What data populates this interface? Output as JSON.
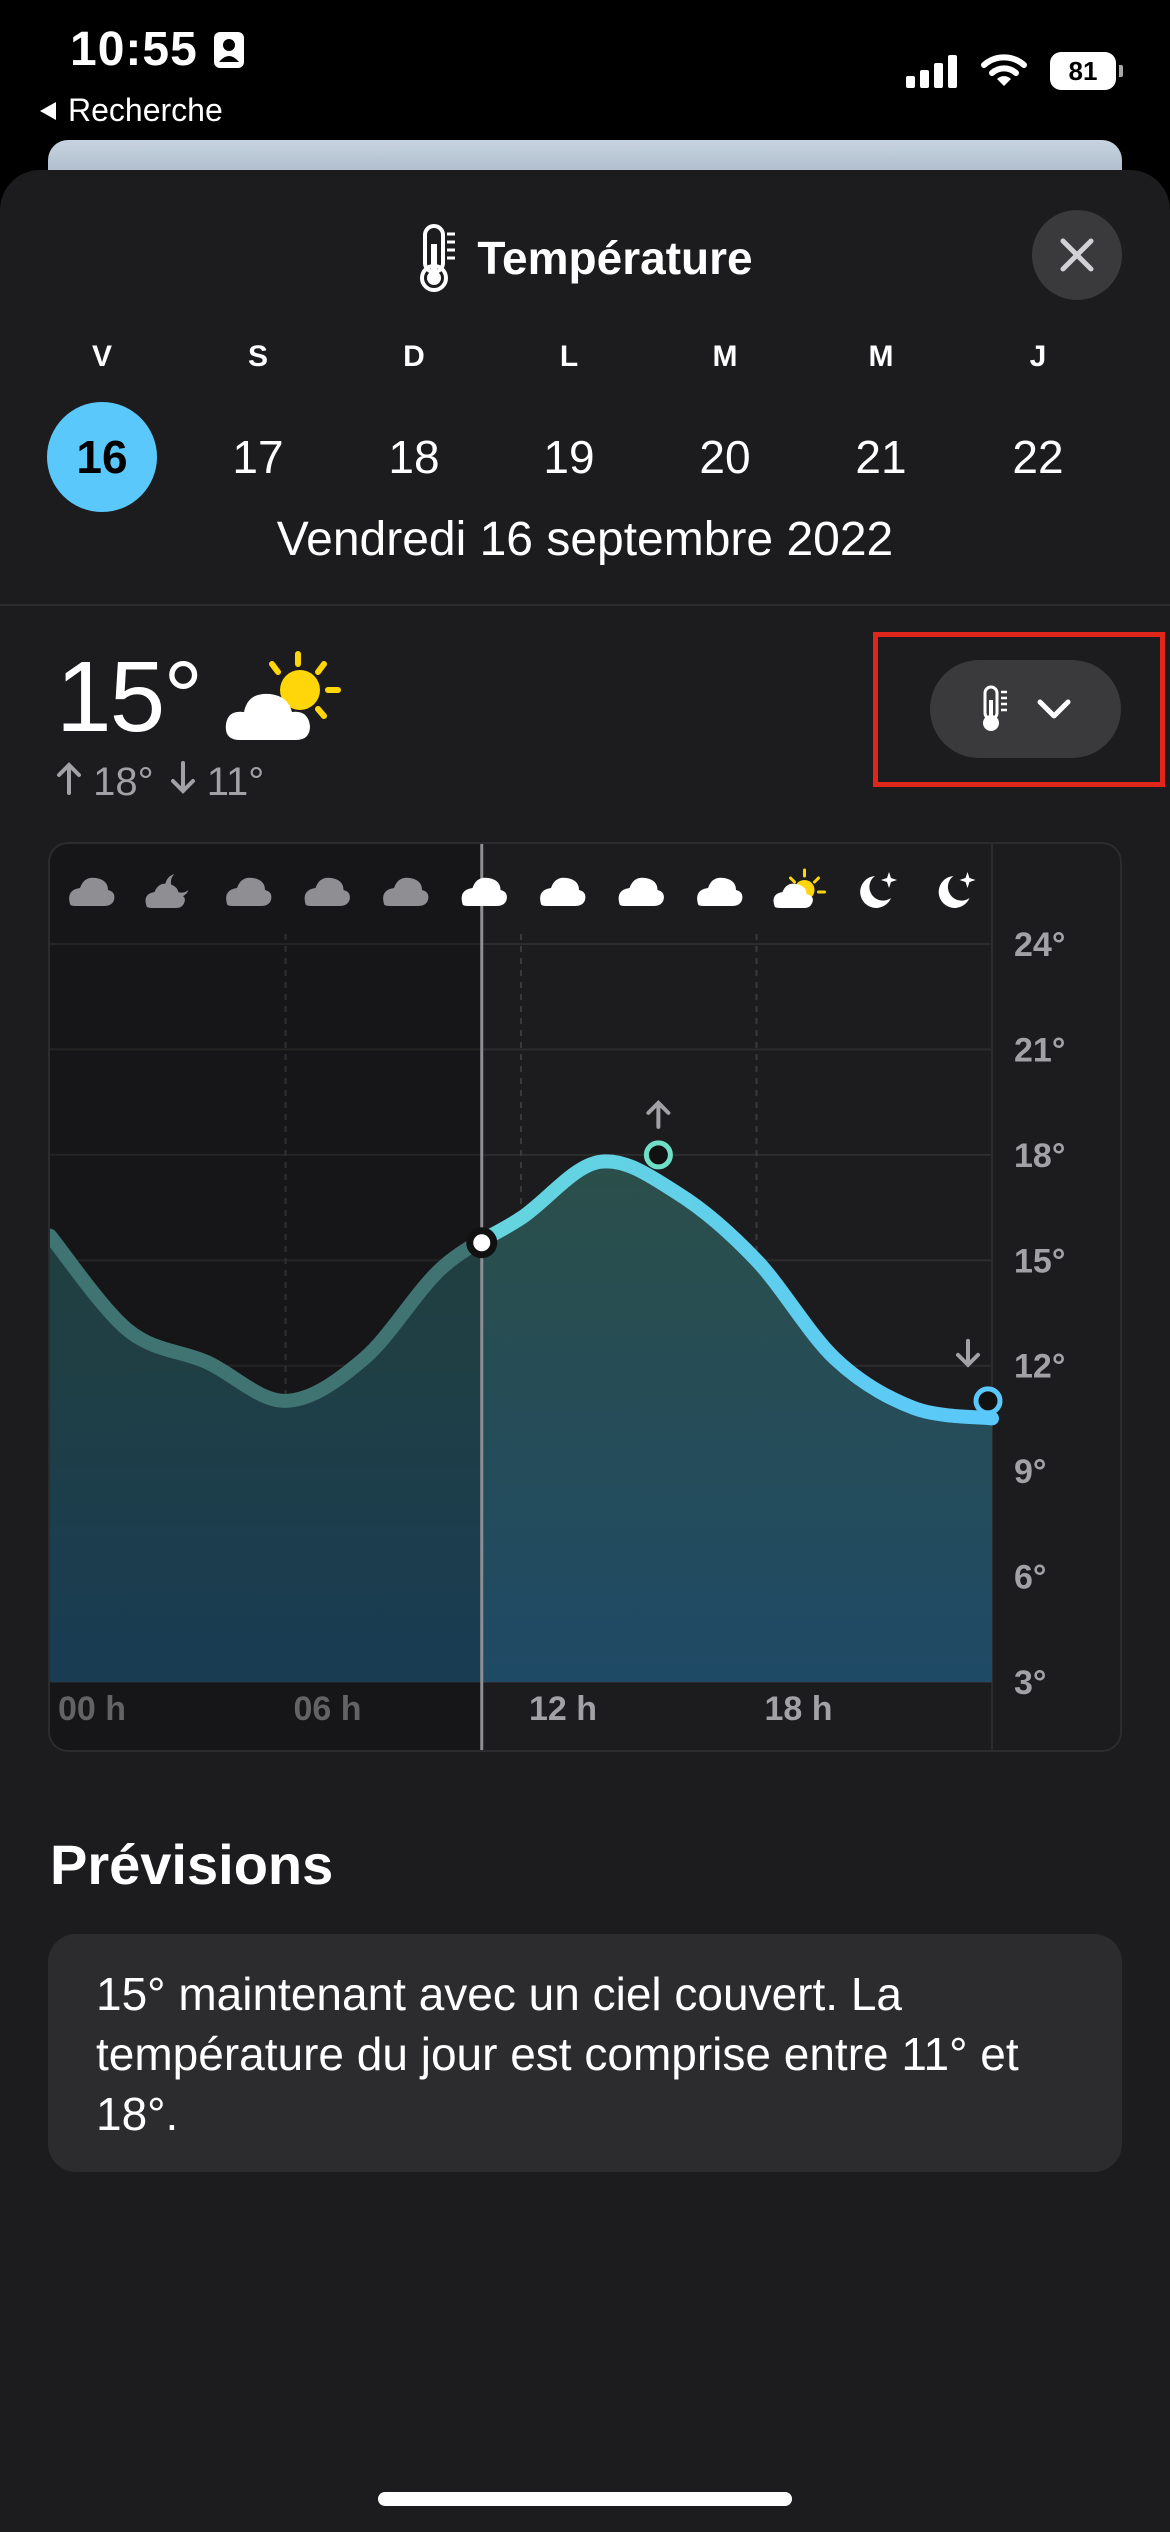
{
  "status_bar": {
    "time": "10:55",
    "back_label": "Recherche",
    "battery": "81"
  },
  "header": {
    "title": "Température"
  },
  "days": [
    {
      "letter": "V",
      "num": "16",
      "selected": true
    },
    {
      "letter": "S",
      "num": "17",
      "selected": false
    },
    {
      "letter": "D",
      "num": "18",
      "selected": false
    },
    {
      "letter": "L",
      "num": "19",
      "selected": false
    },
    {
      "letter": "M",
      "num": "20",
      "selected": false
    },
    {
      "letter": "M",
      "num": "21",
      "selected": false
    },
    {
      "letter": "J",
      "num": "22",
      "selected": false
    }
  ],
  "selected_date": "Vendredi 16 septembre 2022",
  "current": {
    "temp": "15°",
    "high": "18°",
    "low": "11°"
  },
  "hourly_icons": [
    "cloud",
    "cloud-moon",
    "cloud",
    "cloud",
    "cloud",
    "cloud",
    "cloud",
    "cloud",
    "cloud",
    "cloud-sun",
    "moon",
    "moon"
  ],
  "chart_data": {
    "type": "area",
    "x": [
      0,
      2,
      4,
      6,
      8,
      10,
      12,
      14,
      16,
      18,
      20,
      22,
      24
    ],
    "y": [
      15.7,
      13.0,
      12.1,
      11.0,
      12.2,
      14.8,
      16.2,
      17.8,
      16.9,
      15.0,
      12.2,
      10.8,
      10.5
    ],
    "x_ticks": [
      "00 h",
      "06 h",
      "12 h",
      "18 h"
    ],
    "y_ticks": [
      "24°",
      "21°",
      "18°",
      "15°",
      "12°",
      "9°",
      "6°",
      "3°"
    ],
    "ylim": [
      3,
      24
    ],
    "xlim": [
      0,
      24
    ],
    "current_hour": 11,
    "high_point": {
      "x": 15.5,
      "y": 18
    },
    "low_point": {
      "x": 24,
      "y": 11
    },
    "colors": {
      "line_past": "#4e8e8c",
      "line_future_start": "#6fe0c5",
      "line_future_end": "#5ac8fa",
      "fill_top": "#2b4f4a",
      "fill_bottom": "#1f4a66"
    }
  },
  "forecast": {
    "title": "Prévisions",
    "text": "15° maintenant avec un ciel couvert. La température du jour est comprise entre 11° et 18°."
  }
}
